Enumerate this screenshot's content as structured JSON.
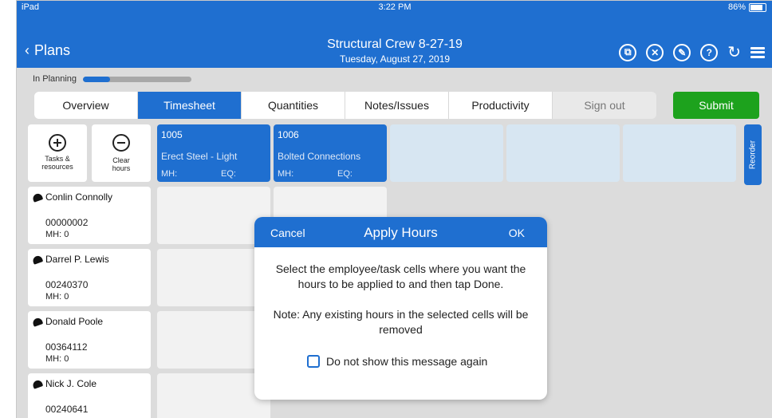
{
  "status_bar": {
    "device": "iPad",
    "time": "3:22 PM",
    "battery": "86%"
  },
  "header": {
    "back_label": "Plans",
    "title": "Structural Crew 8-27-19",
    "subtitle": "Tuesday, August 27, 2019",
    "icons": [
      "copy-icon",
      "trash-icon",
      "edit-icon",
      "help-icon",
      "refresh-icon",
      "menu-icon"
    ]
  },
  "planning": {
    "label": "In Planning",
    "progress": 0.25
  },
  "tabs": [
    {
      "label": "Overview"
    },
    {
      "label": "Timesheet",
      "active": true
    },
    {
      "label": "Quantities"
    },
    {
      "label": "Notes/Issues"
    },
    {
      "label": "Productivity"
    },
    {
      "label": "Sign out"
    }
  ],
  "submit_label": "Submit",
  "tools": {
    "tasks_resources": [
      "Tasks &",
      "resources"
    ],
    "clear_hours": [
      "Clear",
      "hours"
    ]
  },
  "tasks": [
    {
      "code": "1005",
      "name": "Erect Steel - Light",
      "mh": "MH:",
      "eq": "EQ:"
    },
    {
      "code": "1006",
      "name": "Bolted Connections",
      "mh": "MH:",
      "eq": "EQ:"
    }
  ],
  "reorder_label": "Reorder",
  "employees": [
    {
      "name": "Conlin Connolly",
      "id": "00000002",
      "mh": "MH: 0"
    },
    {
      "name": "Darrel P. Lewis",
      "id": "00240370",
      "mh": "MH: 0"
    },
    {
      "name": "Donald Poole",
      "id": "00364112",
      "mh": "MH: 0"
    },
    {
      "name": "Nick J. Cole",
      "id": "00240641",
      "mh": ""
    }
  ],
  "modal": {
    "cancel": "Cancel",
    "title": "Apply Hours",
    "ok": "OK",
    "message": "Select the employee/task cells where you want the hours to be applied to and then tap Done.",
    "note": "Note: Any existing hours in the selected cells will be removed",
    "checkbox_label": "Do not show this message again",
    "checkbox_checked": false
  },
  "colors": {
    "primary": "#1f6fd0",
    "submit": "#1da21d",
    "task_empty": "#d7e6f2"
  }
}
